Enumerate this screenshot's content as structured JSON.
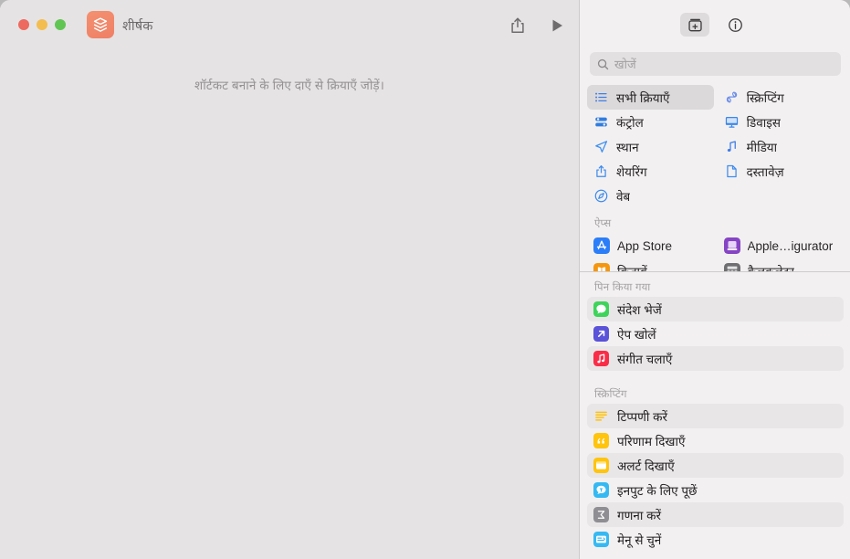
{
  "window": {
    "title": "शीर्षक",
    "app_icon_name": "shortcuts-app-icon",
    "accent": "#ee8066"
  },
  "titlebar": {
    "traffic_lights": [
      {
        "name": "close-button",
        "color": "#ec6a5f"
      },
      {
        "name": "minimize-button",
        "color": "#f4bd50"
      },
      {
        "name": "zoom-button",
        "color": "#61c554"
      }
    ],
    "share_label": "share-icon",
    "run_label": "run-icon"
  },
  "editor": {
    "empty_message": "शॉर्टकट बनाने के लिए दाएँ से क्रियाएँ जोड़ें।"
  },
  "library": {
    "tabs": [
      {
        "name": "action-library-tab",
        "icon": "add-action-icon",
        "selected": true
      },
      {
        "name": "shortcut-details-tab",
        "icon": "info-icon",
        "selected": false
      }
    ],
    "search": {
      "placeholder": "खोजें",
      "value": "",
      "icon": "search-icon"
    },
    "categories": [
      {
        "label": "सभी क्रियाएँ",
        "icon": "list-bullet-icon",
        "color": "#3e7fe8",
        "selected": true
      },
      {
        "label": "स्क्रिप्टिंग",
        "icon": "scripting-icon",
        "color": "#6f8fe8",
        "selected": false
      },
      {
        "label": "कंट्रोल",
        "icon": "sliders-icon",
        "color": "#2f7de0",
        "selected": false
      },
      {
        "label": "डिवाइस",
        "icon": "display-icon",
        "color": "#3b86e8",
        "selected": false
      },
      {
        "label": "स्थान",
        "icon": "location-arrow-icon",
        "color": "#3e90f0",
        "selected": false
      },
      {
        "label": "मीडिया",
        "icon": "music-note-icon",
        "color": "#3d7ce8",
        "selected": false
      },
      {
        "label": "शेयरिंग",
        "icon": "share-up-icon",
        "color": "#3e8bee",
        "selected": false
      },
      {
        "label": "दस्तावेज़",
        "icon": "document-page-icon",
        "color": "#3e8bee",
        "selected": false
      },
      {
        "label": "वेब",
        "icon": "compass-icon",
        "color": "#3e8bee",
        "selected": false
      }
    ],
    "apps_header": "ऐप्स",
    "apps": [
      {
        "label": "App Store",
        "icon": "app-store-icon",
        "color": "#2c7ef8"
      },
      {
        "label": "Apple…igurator",
        "icon": "apple-configurator-icon",
        "color": "#8645c4"
      },
      {
        "label": "किताबें",
        "icon": "books-icon",
        "color": "#f5960f"
      },
      {
        "label": "कैलकुलेटर",
        "icon": "calculator-icon",
        "color": "#6f6f72"
      }
    ],
    "pinned_header": "पिन किया गया",
    "pinned_actions": [
      {
        "label": "संदेश भेजें",
        "icon": "messages-icon",
        "color": "#3ed45a"
      },
      {
        "label": "ऐप खोलें",
        "icon": "open-app-icon",
        "color": "#5a52d8"
      },
      {
        "label": "संगीत चलाएँ",
        "icon": "music-app-icon",
        "color": "#fa2d48"
      }
    ],
    "scripting_header": "स्क्रिप्टिंग",
    "scripting_actions": [
      {
        "label": "टिप्पणी करें",
        "icon": "comment-icon",
        "color": "#ffc209"
      },
      {
        "label": "परिणाम दिखाएँ",
        "icon": "show-result-icon",
        "color": "#ffc40d"
      },
      {
        "label": "अलर्ट दिखाएँ",
        "icon": "show-alert-icon",
        "color": "#ffc40d"
      },
      {
        "label": "इनपुट के लिए पूछें",
        "icon": "ask-for-input-icon",
        "color": "#35b9f2"
      },
      {
        "label": "गणना करें",
        "icon": "calculate-icon",
        "color": "#8e8e93"
      },
      {
        "label": "मेनू से चुनें",
        "icon": "choose-from-menu-icon",
        "color": "#35b9f2"
      }
    ]
  }
}
